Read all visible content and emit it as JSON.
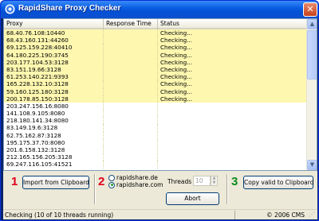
{
  "window": {
    "title": "RapidShare Proxy Checker",
    "close_label": "✕"
  },
  "list": {
    "columns": [
      "Proxy",
      "Response Time",
      "Status"
    ],
    "rows": [
      {
        "proxy": "68.40.76.108:10440",
        "response": "",
        "status": "Checking...",
        "checking": true
      },
      {
        "proxy": "68.43.160.131:44260",
        "response": "",
        "status": "Checking...",
        "checking": true
      },
      {
        "proxy": "69.125.159.228:40410",
        "response": "",
        "status": "Checking...",
        "checking": true
      },
      {
        "proxy": "64.180.225.190:3745",
        "response": "",
        "status": "Checking...",
        "checking": true
      },
      {
        "proxy": "203.177.104.53:3128",
        "response": "",
        "status": "Checking...",
        "checking": true
      },
      {
        "proxy": "83.151.19.66:3128",
        "response": "",
        "status": "Checking...",
        "checking": true
      },
      {
        "proxy": "61.253.140.221:9393",
        "response": "",
        "status": "Checking...",
        "checking": true
      },
      {
        "proxy": "165.228.132.10:3128",
        "response": "",
        "status": "Checking...",
        "checking": true
      },
      {
        "proxy": "59.160.125.180:3128",
        "response": "",
        "status": "Checking...",
        "checking": true
      },
      {
        "proxy": "200.178.85.150:3128",
        "response": "",
        "status": "Checking...",
        "checking": true
      },
      {
        "proxy": "203.247.156.16:8080",
        "response": "",
        "status": "",
        "checking": false
      },
      {
        "proxy": "141.108.9.105:8080",
        "response": "",
        "status": "",
        "checking": false
      },
      {
        "proxy": "218.180.141.34:8080",
        "response": "",
        "status": "",
        "checking": false
      },
      {
        "proxy": "83.149.19.6:3128",
        "response": "",
        "status": "",
        "checking": false
      },
      {
        "proxy": "62.75.162.87:3128",
        "response": "",
        "status": "",
        "checking": false
      },
      {
        "proxy": "195.175.37.70:8080",
        "response": "",
        "status": "",
        "checking": false
      },
      {
        "proxy": "201.6.158.132:3128",
        "response": "",
        "status": "",
        "checking": false
      },
      {
        "proxy": "212.165.156.205:3128",
        "response": "",
        "status": "",
        "checking": false
      },
      {
        "proxy": "69.247.116.105:41521",
        "response": "",
        "status": "",
        "checking": false
      }
    ]
  },
  "controls": {
    "step1": "1",
    "step2": "2",
    "step3": "3",
    "import_label": "Import from Clipboard",
    "host_options": [
      "rapidshare.de",
      "rapidshare.com"
    ],
    "selected_host": "rapidshare.com",
    "threads_label": "Threads",
    "threads_value": "10",
    "spin_up": "▲",
    "spin_down": "▼",
    "abort_label": "Abort",
    "copy_label": "Copy valid to Clipboard"
  },
  "status": {
    "left": "Checking (10 of 10 threads running)",
    "right": "© 2006 CMS"
  },
  "colors": {
    "checking_row": "#fdf7b0",
    "step_red": "#e0001b",
    "step_green": "#0b8a1d",
    "titlebar": "#0551d6"
  }
}
